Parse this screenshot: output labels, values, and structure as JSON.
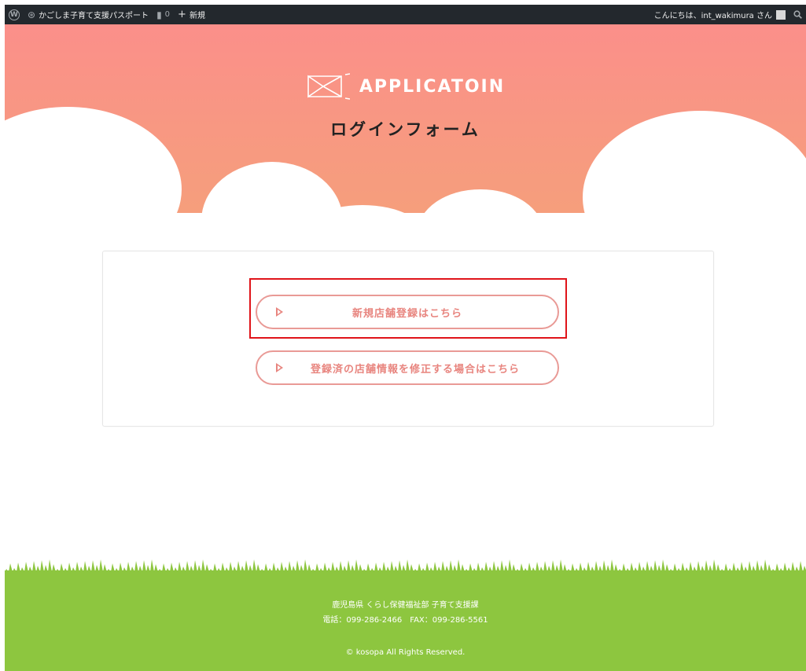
{
  "admin_bar": {
    "site_name": "かごしま子育て支援パスポート",
    "comments_count": "0",
    "new_label": "新規",
    "greeting": "こんにちは、int_wakimura さん"
  },
  "hero": {
    "logo_text": "APPLICATOIN",
    "title": "ログインフォーム"
  },
  "buttons": {
    "register_new": "新規店舗登録はこちら",
    "edit_registered": "登録済の店舗情報を修正する場合はこちら"
  },
  "footer": {
    "department": "鹿児島県 くらし保健福祉部 子育て支援課",
    "contact": "電話：099-286-2466　FAX：099-286-5561",
    "copyright": "© kosopa All Rights Reserved."
  },
  "colors": {
    "accent": "#e8857f",
    "hero_top": "#fb8f8a",
    "footer_green": "#8dc63f",
    "highlight_red": "#e0141a"
  }
}
